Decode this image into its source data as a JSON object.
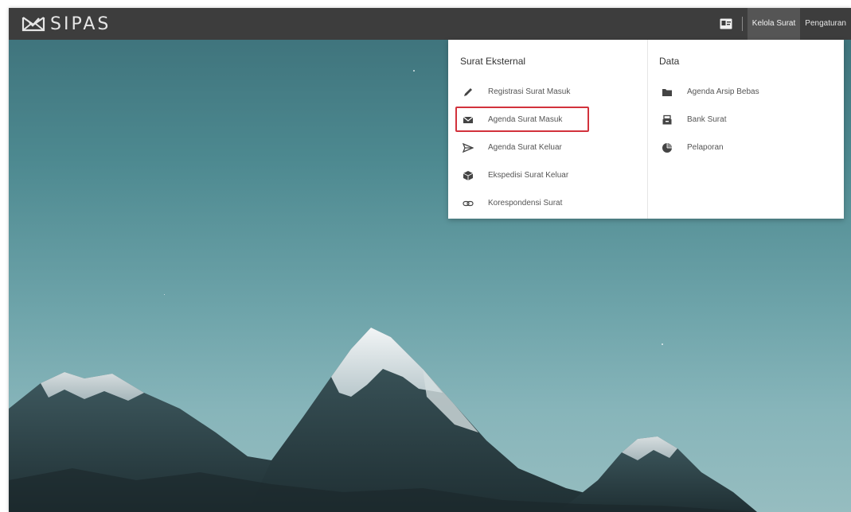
{
  "app": {
    "name": "SIPAS",
    "logo_icon": "envelope-check-icon"
  },
  "navbar": {
    "profile_icon": "id-card-icon",
    "links": [
      {
        "label": "Kelola Surat",
        "active": true
      },
      {
        "label": "Pengaturan",
        "active": false
      }
    ]
  },
  "dropdown": {
    "left_column": {
      "title": "Surat Eksternal",
      "items": [
        {
          "label": "Registrasi Surat Masuk",
          "icon": "pencil-icon"
        },
        {
          "label": "Agenda Surat Masuk",
          "icon": "envelope-icon",
          "highlighted": true
        },
        {
          "label": "Agenda Surat Keluar",
          "icon": "paper-plane-icon"
        },
        {
          "label": "Ekspedisi Surat Keluar",
          "icon": "cube-icon"
        },
        {
          "label": "Korespondensi Surat",
          "icon": "link-icon"
        }
      ]
    },
    "right_column": {
      "title": "Data",
      "items": [
        {
          "label": "Agenda Arsip Bebas",
          "icon": "folder-icon"
        },
        {
          "label": "Bank Surat",
          "icon": "archive-icon"
        },
        {
          "label": "Pelaporan",
          "icon": "pie-chart-icon"
        }
      ]
    }
  },
  "colors": {
    "navbar_bg": "#3d3d3d",
    "highlight_border": "#d2323c",
    "menu_text": "#555555",
    "icon_color": "#444444"
  }
}
